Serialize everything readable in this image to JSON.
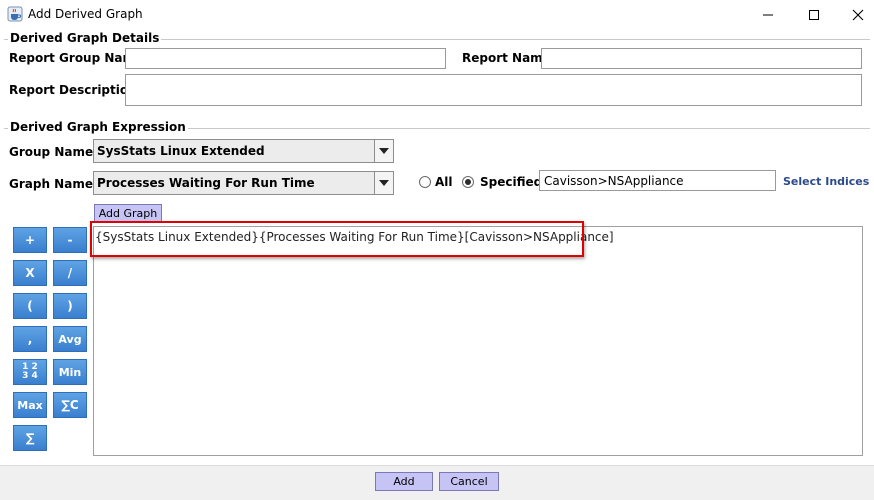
{
  "window": {
    "title": "Add Derived Graph",
    "controls": [
      "minimize",
      "maximize",
      "close"
    ]
  },
  "details": {
    "legend": "Derived Graph Details",
    "report_group_label": "Report Group Name",
    "report_group_value": "",
    "report_name_label": "Report Name",
    "report_name_value": "",
    "report_description_label": "Report Description",
    "report_description_value": ""
  },
  "expression": {
    "legend": "Derived Graph Expression",
    "group_label": "Group Name",
    "group_value": "SysStats Linux Extended",
    "graph_label": "Graph Name",
    "graph_value": "Processes Waiting For Run Time",
    "radio_all_label": "All",
    "radio_specified_label": "Specified",
    "selected_radio": "Specified",
    "indices_value": "Cavisson>NSAppliance",
    "select_indices_label": "Select Indices",
    "add_graph_label": "Add Graph",
    "expression_text": "{SysStats Linux Extended}{Processes Waiting For Run Time}[Cavisson>NSAppliance]"
  },
  "operators": [
    {
      "name": "plus",
      "label": "+"
    },
    {
      "name": "minus",
      "label": "-"
    },
    {
      "name": "multiply",
      "label": "X"
    },
    {
      "name": "divide",
      "label": "/"
    },
    {
      "name": "open-paren",
      "label": "("
    },
    {
      "name": "close-paren",
      "label": ")"
    },
    {
      "name": "comma",
      "label": ","
    },
    {
      "name": "avg",
      "label": "Avg"
    },
    {
      "name": "count",
      "label": "1 2 3 4"
    },
    {
      "name": "min",
      "label": "Min"
    },
    {
      "name": "max",
      "label": "Max"
    },
    {
      "name": "sum-c",
      "label": "∑C"
    },
    {
      "name": "sum",
      "label": "∑"
    }
  ],
  "footer": {
    "add_label": "Add",
    "cancel_label": "Cancel"
  },
  "colors": {
    "operator_button": "#3a7fcf",
    "purple_button": "#c6c4f4",
    "highlight": "#e00000",
    "link": "#2b4a8b"
  },
  "icons": {
    "app": "java-cup-icon",
    "combo": "chevron-down-icon"
  }
}
